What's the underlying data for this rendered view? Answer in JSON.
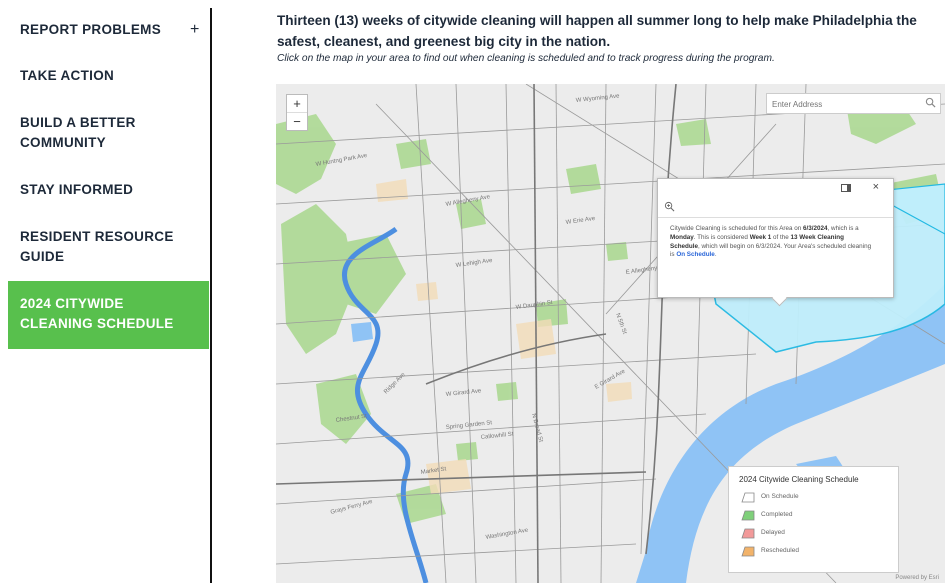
{
  "nav": {
    "items": [
      {
        "label": "REPORT PROBLEMS",
        "expand": "+"
      },
      {
        "label": "TAKE ACTION"
      },
      {
        "label": "BUILD A BETTER",
        "label2": "COMMUNITY"
      },
      {
        "label": "STAY INFORMED"
      },
      {
        "label": "RESIDENT RESOURCE",
        "label2": "GUIDE"
      }
    ],
    "active": {
      "label": "2024 CITYWIDE",
      "label2": "CLEANING SCHEDULE",
      "color": "#58c04d"
    }
  },
  "intro": {
    "line1": "Thirteen (13) weeks of citywide cleaning will happen all summer long to help make Philadelphia the",
    "line2": "safest, cleanest, and greenest big city in the nation.",
    "instructions": "Click on the map in your area to find out when cleaning is scheduled and to track progress during the program."
  },
  "map": {
    "zoom_in": "+",
    "zoom_out": "−",
    "search_placeholder": "Enter Address",
    "search_icon": "search-icon",
    "popup": {
      "close": "×",
      "text_a": "Citywide Cleaning is scheduled for this Area on ",
      "date": "6/3/2024",
      "text_b": ", which is a ",
      "day": "Monday",
      "text_c": ". This is considered ",
      "week": "Week 1",
      "text_d": " of the ",
      "schedule": "13 Week Cleaning Schedule",
      "text_e": ", which will begin on 6/3/2024. Your Area's scheduled cleaning is ",
      "status": "On Schedule",
      "text_f": "."
    },
    "legend": {
      "title": "2024 Citywide Cleaning Schedule",
      "items": [
        {
          "label": "On Schedule",
          "color": "#ffffff"
        },
        {
          "label": "Completed",
          "color": "#7fd07a"
        },
        {
          "label": "Delayed",
          "color": "#f29a9a"
        },
        {
          "label": "Rescheduled",
          "color": "#f2b36a"
        }
      ]
    },
    "street_labels": [
      "W Huntng Park Ave",
      "W Allegheny Ave",
      "W Erie Ave",
      "E Allegheny Ave",
      "W Lehigh Ave",
      "W Dauphin St",
      "W Girard Ave",
      "Ridge Ave",
      "E Girard Ave",
      "Market St",
      "Chestnut St",
      "Spring Garden St",
      "Callowhill St",
      "Washington Ave",
      "Grays Ferry Ave",
      "N Broad St",
      "N 5th St",
      "W Wyoming Ave"
    ],
    "powered_by": "Powered by Esri",
    "colors": {
      "water": "#8fc3f5",
      "park": "#a9d88e",
      "area_fill": "#bfeefb",
      "area_stroke": "#22b9e3",
      "roads": "#9a9a9a"
    }
  }
}
